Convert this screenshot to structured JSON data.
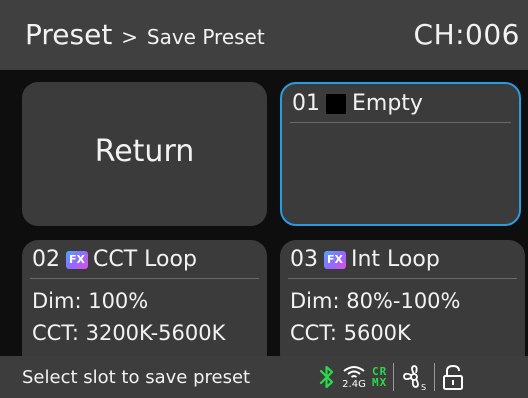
{
  "header": {
    "title": "Preset",
    "separator": ">",
    "subtitle": "Save Preset",
    "channel": "CH:006"
  },
  "return_button": {
    "label": "Return"
  },
  "slots": [
    {
      "number": "01",
      "name": "Empty",
      "icon": "black-swatch-icon",
      "selected": true
    },
    {
      "number": "02",
      "name": "CCT Loop",
      "icon": "fx-icon",
      "fx_label": "FX",
      "dim": "Dim: 100%",
      "cct": "CCT: 3200K-5600K"
    },
    {
      "number": "03",
      "name": "Int Loop",
      "icon": "fx-icon",
      "fx_label": "FX",
      "dim": "Dim: 80%-100%",
      "cct": "CCT: 5600K"
    }
  ],
  "status_bar": {
    "message": "Select slot to save preset",
    "icons": [
      "bluetooth-icon",
      "wireless-2.4g-icon",
      "crmx-icon",
      "fan-icon",
      "unlock-icon"
    ],
    "wireless_label": "2.4G",
    "crmx_top": "CR",
    "crmx_bottom": "MX"
  },
  "colors": {
    "header_bg": "#404040",
    "tile_bg": "#3b3b3b",
    "selected_border": "#2a9be0",
    "status_green": "#2bd84b",
    "background": "#0e0e0e"
  }
}
